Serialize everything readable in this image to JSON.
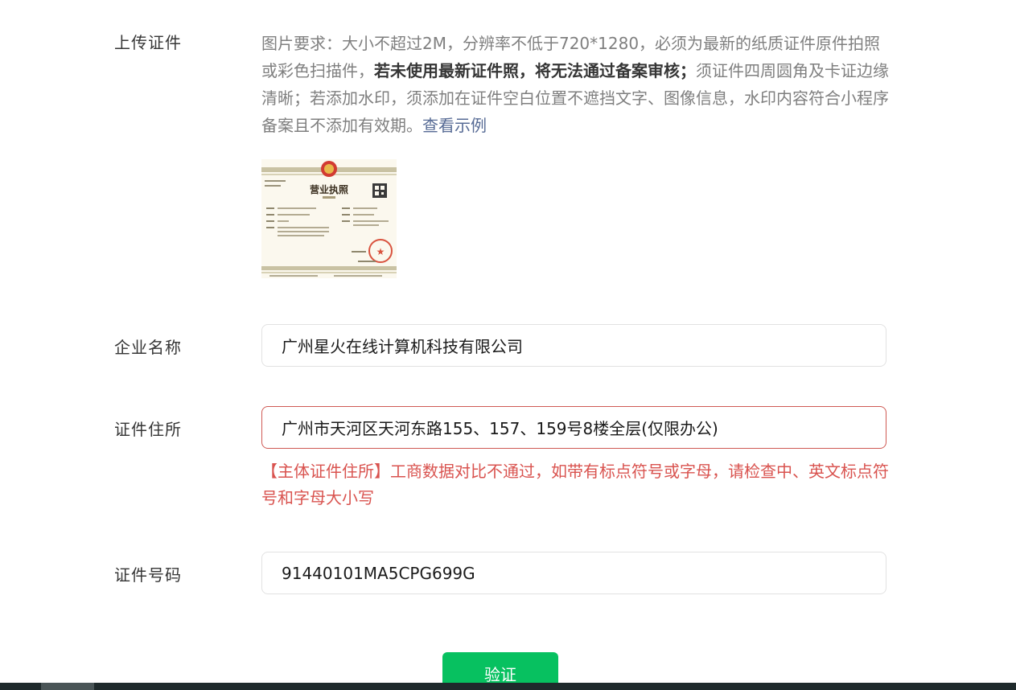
{
  "upload": {
    "label": "上传证件",
    "hint_part1": "图片要求：大小不超过2M，分辨率不低于720*1280，必须为最新的纸质证件原件拍照或彩色扫描件，",
    "hint_bold": "若未使用最新证件照，将无法通过备案审核；",
    "hint_part2": "须证件四周圆角及卡证边缘清晰；若添加水印，须添加在证件空白位置不遮挡文字、图像信息，水印内容符合小程序备案且不添加有效期。",
    "example_link": "查看示例",
    "license_title": "营业执照"
  },
  "company_name": {
    "label": "企业名称",
    "value": "广州星火在线计算机科技有限公司"
  },
  "address": {
    "label": "证件住所",
    "value": "广州市天河区天河东路155、157、159号8楼全层(仅限办公)",
    "error": "【主体证件住所】工商数据对比不通过，如带有标点符号或字母，请检查中、英文标点符号和字母大小写"
  },
  "license_number": {
    "label": "证件号码",
    "value": "91440101MA5CPG699G"
  },
  "actions": {
    "verify_label": "验证"
  },
  "colors": {
    "primary": "#07c160",
    "error": "#d9534f",
    "link": "#576b95"
  }
}
